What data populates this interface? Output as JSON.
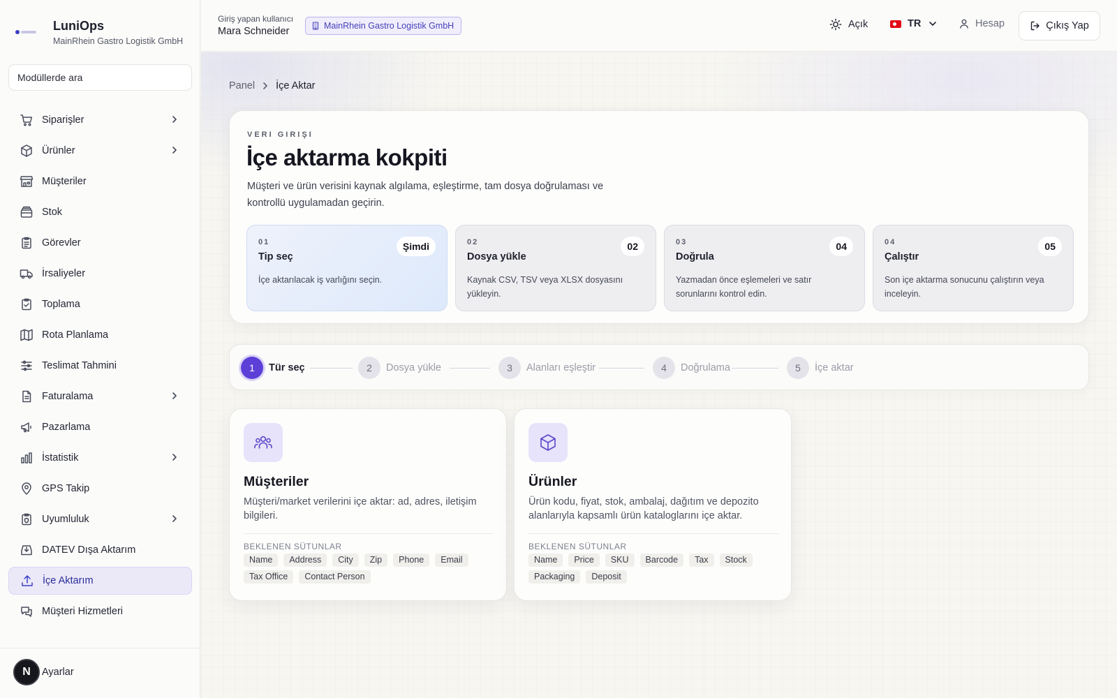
{
  "brand": {
    "name": "LuniOps",
    "company": "MainRhein Gastro Logistik GmbH"
  },
  "sidebar": {
    "search_placeholder": "Modüllerde ara",
    "items": [
      {
        "label": "Siparişler",
        "icon": "cart-icon",
        "chevron": true
      },
      {
        "label": "Ürünler",
        "icon": "box-icon",
        "chevron": true
      },
      {
        "label": "Müşteriler",
        "icon": "store-icon",
        "chevron": false
      },
      {
        "label": "Stok",
        "icon": "archive-icon",
        "chevron": false
      },
      {
        "label": "Görevler",
        "icon": "clipboard-icon",
        "chevron": false
      },
      {
        "label": "İrsaliyeler",
        "icon": "truck-icon",
        "chevron": false
      },
      {
        "label": "Toplama",
        "icon": "clipboard-check-icon",
        "chevron": false
      },
      {
        "label": "Rota Planlama",
        "icon": "map-icon",
        "chevron": false
      },
      {
        "label": "Teslimat Tahmini",
        "icon": "sliders-icon",
        "chevron": false
      },
      {
        "label": "Faturalama",
        "icon": "invoice-icon",
        "chevron": true
      },
      {
        "label": "Pazarlama",
        "icon": "megaphone-icon",
        "chevron": false
      },
      {
        "label": "İstatistik",
        "icon": "bar-chart-icon",
        "chevron": true
      },
      {
        "label": "GPS Takip",
        "icon": "map-pin-icon",
        "chevron": false
      },
      {
        "label": "Uyumluluk",
        "icon": "clipboard-shield-icon",
        "chevron": true
      },
      {
        "label": "DATEV Dışa Aktarım",
        "icon": "tray-download-icon",
        "chevron": false
      },
      {
        "label": "İçe Aktarım",
        "icon": "upload-icon",
        "chevron": false,
        "active": true
      },
      {
        "label": "Müşteri Hizmetleri",
        "icon": "chat-icon",
        "chevron": false
      }
    ],
    "settings": {
      "avatar": "N",
      "label": "Ayarlar"
    }
  },
  "topbar": {
    "user_caption": "Giriş yapan kullanıcı",
    "user_name": "Mara Schneider",
    "company_badge": "MainRhein Gastro Logistik GmbH",
    "theme_label": "Açık",
    "language": "TR",
    "account_label": "Hesap",
    "logout_label": "Çıkış Yap"
  },
  "breadcrumb": {
    "home": "Panel",
    "current": "İçe Aktar"
  },
  "hero": {
    "eyebrow": "VERI GIRIŞI",
    "title": "İçe aktarma kokpiti",
    "description": "Müşteri ve ürün verisini kaynak algılama, eşleştirme, tam dosya doğrulaması ve kontrollü uygulamadan geçirin.",
    "steps": [
      {
        "num": "01",
        "title": "Tip seç",
        "desc": "İçe aktarılacak iş varlığını seçin.",
        "pill": "Şimdi",
        "current": true
      },
      {
        "num": "02",
        "title": "Dosya yükle",
        "desc": "Kaynak CSV, TSV veya XLSX dosyasını yükleyin.",
        "pill": "02"
      },
      {
        "num": "03",
        "title": "Doğrula",
        "desc": "Yazmadan önce eşlemeleri ve satır sorunlarını kontrol edin.",
        "pill": "04"
      },
      {
        "num": "04",
        "title": "Çalıştır",
        "desc": "Son içe aktarma sonucunu çalıştırın veya inceleyin.",
        "pill": "05"
      }
    ]
  },
  "stepper": [
    {
      "n": "1",
      "label": "Tür seç",
      "active": true
    },
    {
      "n": "2",
      "label": "Dosya yükle"
    },
    {
      "n": "3",
      "label": "Alanları eşleştir"
    },
    {
      "n": "4",
      "label": "Doğrulama"
    },
    {
      "n": "5",
      "label": "İçe aktar"
    }
  ],
  "entities": [
    {
      "title": "Müşteriler",
      "icon": "users-icon",
      "description": "Müşteri/market verilerini içe aktar: ad, adres, iletişim bilgileri.",
      "columns_label": "BEKLENEN SÜTUNLAR",
      "columns": [
        "Name",
        "Address",
        "City",
        "Zip",
        "Phone",
        "Email",
        "Tax Office",
        "Contact Person"
      ]
    },
    {
      "title": "Ürünler",
      "icon": "box-icon",
      "description": "Ürün kodu, fiyat, stok, ambalaj, dağıtım ve depozito alanlarıyla kapsamlı ürün kataloglarını içe aktar.",
      "columns_label": "BEKLENEN SÜTUNLAR",
      "columns": [
        "Name",
        "Price",
        "SKU",
        "Barcode",
        "Tax",
        "Stock",
        "Packaging",
        "Deposit"
      ]
    }
  ],
  "colors": {
    "accent": "#5b3fd6",
    "active_nav_bg": "#ebe9f8",
    "badge_border": "#b9b3ee"
  }
}
